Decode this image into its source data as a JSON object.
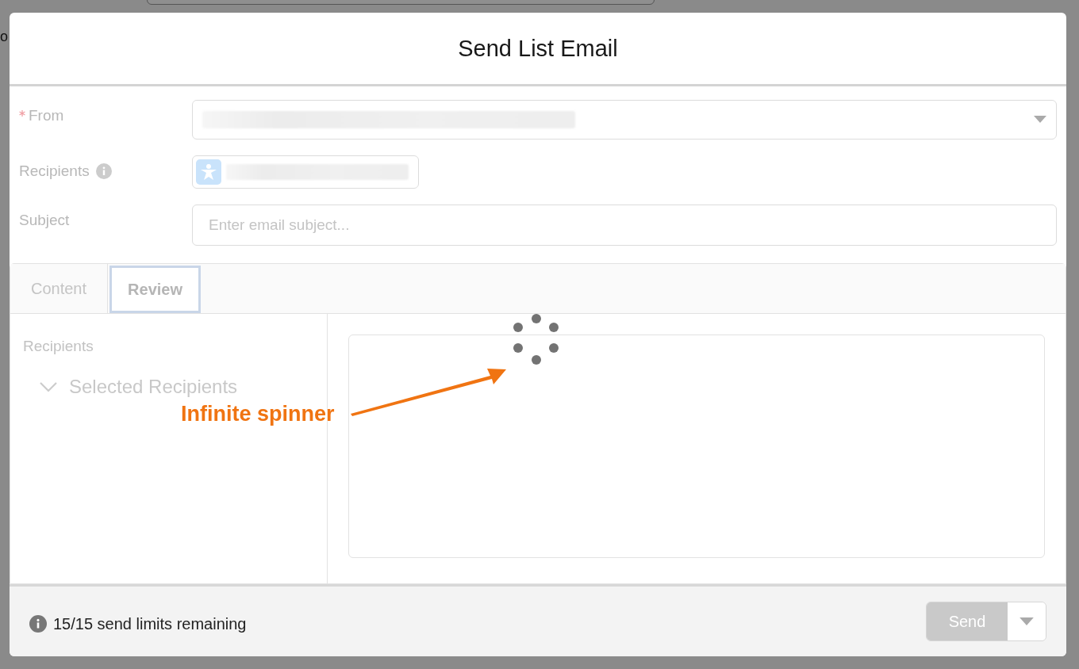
{
  "backdrop": {
    "text": "o"
  },
  "modal": {
    "title": "Send List Email"
  },
  "form": {
    "from": {
      "label": "From",
      "required": true
    },
    "recipients": {
      "label": "Recipients"
    },
    "subject": {
      "label": "Subject",
      "placeholder": "Enter email subject..."
    }
  },
  "tabs": [
    {
      "label": "Content",
      "selected": false
    },
    {
      "label": "Review",
      "selected": true
    }
  ],
  "review": {
    "heading": "Recipients",
    "tree": [
      {
        "label": "Selected Recipients",
        "expanded": true
      }
    ],
    "loading": true
  },
  "annotation": {
    "text": "Infinite spinner"
  },
  "footer": {
    "limits": "15/15 send limits remaining",
    "send": {
      "label": "Send",
      "disabled": true
    }
  }
}
